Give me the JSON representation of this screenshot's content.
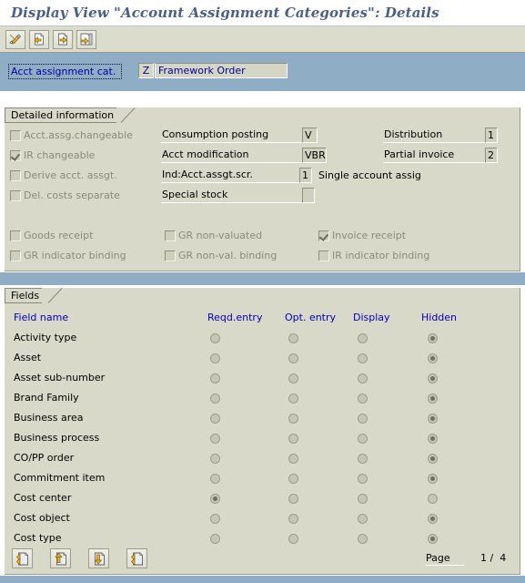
{
  "window": {
    "title": "Display View \"Account Assignment Categories\": Details"
  },
  "toolbar": {
    "buttons": [
      {
        "name": "display-change-icon",
        "label": "Display/Change"
      },
      {
        "name": "previous-object-icon",
        "label": "Previous object"
      },
      {
        "name": "next-object-icon",
        "label": "Next object"
      },
      {
        "name": "details-icon",
        "label": "Details"
      }
    ]
  },
  "key_field": {
    "label": "Acct assignment cat.",
    "code": "Z",
    "description": "Framework Order"
  },
  "detailed_information": {
    "title": "Detailed information",
    "checkboxes": [
      {
        "label": "Acct.assg.changeable",
        "checked": false,
        "enabled": false
      },
      {
        "label": "IR changeable",
        "checked": true,
        "enabled": false
      },
      {
        "label": "Derive acct. assgt.",
        "checked": false,
        "enabled": false
      },
      {
        "label": "Del. costs separate",
        "checked": false,
        "enabled": false
      }
    ],
    "fields_mid": [
      {
        "label": "Consumption posting",
        "value": "V"
      },
      {
        "label": "Acct modification",
        "value": "VBR"
      },
      {
        "label": "Ind:Acct.assgt.scr.",
        "value": "1",
        "extra": "Single account assig"
      },
      {
        "label": "Special stock",
        "value": ""
      }
    ],
    "fields_right": [
      {
        "label": "Distribution",
        "value": "1"
      },
      {
        "label": "Partial invoice",
        "value": "2"
      }
    ],
    "receipt_checkboxes": [
      {
        "label": "Goods receipt",
        "checked": false
      },
      {
        "label": "GR non-valuated",
        "checked": false
      },
      {
        "label": "Invoice receipt",
        "checked": true
      },
      {
        "label": "GR indicator binding",
        "checked": false
      },
      {
        "label": "GR non-val. binding",
        "checked": false
      },
      {
        "label": "IR indicator binding",
        "checked": false
      }
    ]
  },
  "fields_section": {
    "title": "Fields",
    "columns": [
      "Field name",
      "Reqd.entry",
      "Opt. entry",
      "Display",
      "Hidden"
    ],
    "rows": [
      {
        "name": "Activity type",
        "selected": "Hidden"
      },
      {
        "name": "Asset",
        "selected": "Hidden"
      },
      {
        "name": "Asset sub-number",
        "selected": "Hidden"
      },
      {
        "name": "Brand Family",
        "selected": "Hidden"
      },
      {
        "name": "Business area",
        "selected": "Hidden"
      },
      {
        "name": "Business process",
        "selected": "Hidden"
      },
      {
        "name": "CO/PP order",
        "selected": "Hidden"
      },
      {
        "name": "Commitment item",
        "selected": "Hidden"
      },
      {
        "name": "Cost center",
        "selected": "Reqd.entry"
      },
      {
        "name": "Cost object",
        "selected": "Hidden"
      },
      {
        "name": "Cost type",
        "selected": "Hidden"
      }
    ],
    "nav_buttons": [
      {
        "name": "first-page-icon",
        "label": "First page"
      },
      {
        "name": "previous-page-icon",
        "label": "Previous page"
      },
      {
        "name": "next-page-icon",
        "label": "Next page"
      },
      {
        "name": "last-page-icon",
        "label": "Last page"
      }
    ],
    "page_label": "Page",
    "page_value": "1 /  4"
  },
  "colors": {
    "title_text": "#4a5f8e",
    "blue_strip": "#8fadc4",
    "panel_bg": "#d9d9c9",
    "link_blue": "#0000c0"
  }
}
